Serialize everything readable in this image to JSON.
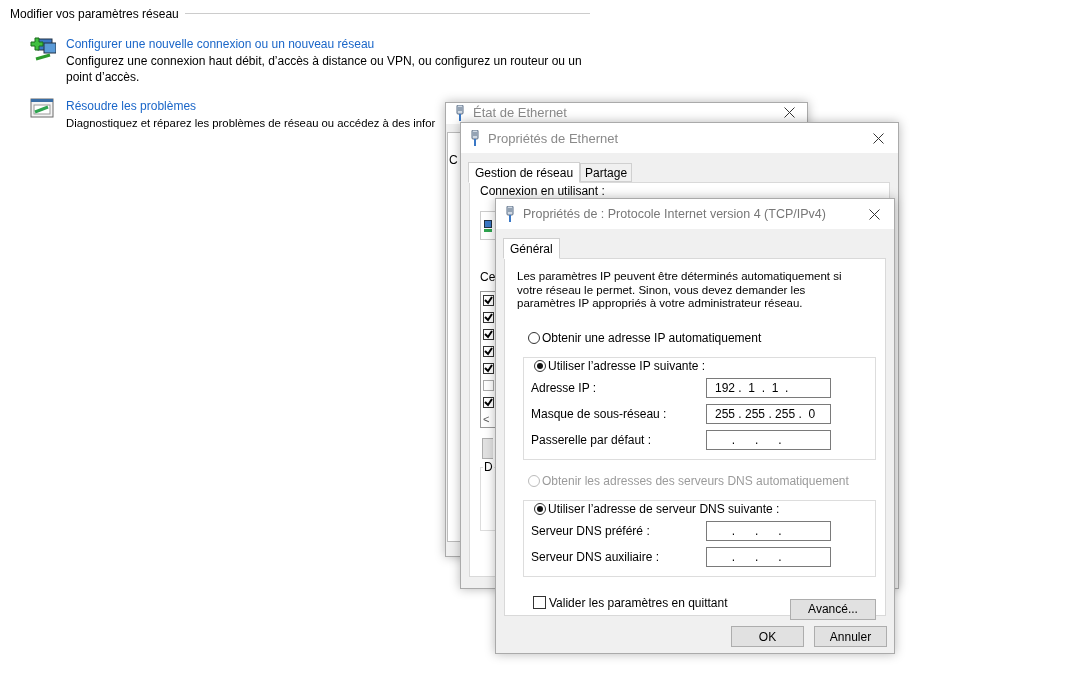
{
  "control_panel": {
    "heading": "Modifier vos paramètres réseau",
    "tasks": [
      {
        "kind": "new-connection",
        "link": "Configurer une nouvelle connexion ou un nouveau réseau",
        "description": "Configurez une connexion haut débit, d’accès à distance ou VPN, ou configurez un routeur ou un point d’accès."
      },
      {
        "kind": "troubleshoot",
        "link": "Résoudre les problèmes",
        "description": "Diagnostiquez et réparez les problèmes de réseau ou accédez à des infor"
      }
    ]
  },
  "status_window": {
    "title": "État de Ethernet",
    "section_label": "C"
  },
  "properties_window": {
    "title": "Propriétés de Ethernet",
    "tabs": [
      {
        "label": "Gestion de réseau",
        "selected": true
      },
      {
        "label": "Partage",
        "selected": false
      }
    ],
    "connect_using_label": "Connexion en utilisant :",
    "items_label": "Ce",
    "items": [
      {
        "checked": true
      },
      {
        "checked": true
      },
      {
        "checked": true
      },
      {
        "checked": true
      },
      {
        "checked": true
      },
      {
        "checked": false
      },
      {
        "checked": true
      }
    ],
    "scroll_arrow": "<",
    "group_label": "D"
  },
  "ipv4_window": {
    "title": "Propriétés de : Protocole Internet version 4 (TCP/IPv4)",
    "tabs": [
      {
        "label": "Général",
        "selected": true
      }
    ],
    "intro": "Les paramètres IP peuvent être déterminés automatiquement si votre réseau le permet. Sinon, vous devez demander les paramètres IP appropriés à votre administrateur réseau.",
    "ip_options": [
      {
        "label": "Obtenir une adresse IP automatiquement",
        "selected": false,
        "disabled": false
      },
      {
        "label": "Utiliser l’adresse IP suivante :",
        "selected": true,
        "disabled": false
      }
    ],
    "ip_fields": [
      {
        "label": "Adresse IP :",
        "value": "192 .  1  .  1  ."
      },
      {
        "label": "Masque de sous-réseau :",
        "value": "255 . 255 . 255 .  0"
      },
      {
        "label": "Passerelle par défaut :",
        "value": "     .      .      ."
      }
    ],
    "dns_options": [
      {
        "label": "Obtenir les adresses des serveurs DNS automatiquement",
        "selected": false,
        "disabled": true
      },
      {
        "label": "Utiliser l’adresse de serveur DNS suivante :",
        "selected": true,
        "disabled": false
      }
    ],
    "dns_fields": [
      {
        "label": "Serveur DNS préféré :",
        "value": "     .      .      ."
      },
      {
        "label": "Serveur DNS auxiliaire :",
        "value": "     .      .      ."
      }
    ],
    "validate_on_exit": {
      "label": "Valider les paramètres en quittant",
      "checked": false
    },
    "advanced_button": "Avancé...",
    "buttons": [
      "OK",
      "Annuler"
    ]
  }
}
